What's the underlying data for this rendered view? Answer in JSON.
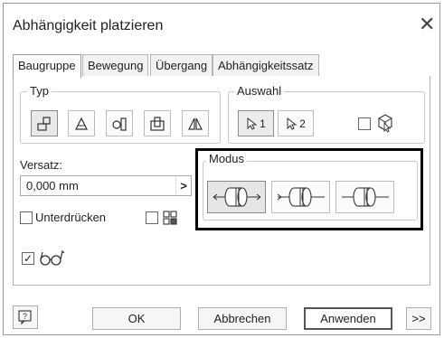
{
  "dialog": {
    "title": "Abhängigkeit platzieren",
    "close_symbol": "✕"
  },
  "tabs": [
    {
      "label": "Baugruppe",
      "active": true
    },
    {
      "label": "Bewegung",
      "active": false
    },
    {
      "label": "Übergang",
      "active": false
    },
    {
      "label": "Abhängigkeitssatz",
      "active": false
    }
  ],
  "type_group": {
    "label": "Typ",
    "buttons": [
      {
        "icon": "mate-constraint-icon",
        "pressed": true
      },
      {
        "icon": "angle-constraint-icon",
        "pressed": false
      },
      {
        "icon": "tangent-constraint-icon",
        "pressed": false
      },
      {
        "icon": "insert-constraint-icon",
        "pressed": false
      },
      {
        "icon": "symmetry-constraint-icon",
        "pressed": false
      }
    ]
  },
  "selection_group": {
    "label": "Auswahl",
    "buttons": [
      {
        "icon": "cursor-select-icon",
        "number": "1",
        "active": true
      },
      {
        "icon": "cursor-select-icon",
        "number": "2",
        "active": false
      }
    ],
    "predict_offset_checked": false,
    "predict_icon": "cube-cursor-icon"
  },
  "offset": {
    "label": "Versatz:",
    "value": "0,000 mm",
    "arrow": ">"
  },
  "suppress": {
    "label": "Unterdrücken",
    "checked": false
  },
  "extra_option": {
    "checked": false,
    "icon": "constraint-glyph-icon"
  },
  "preview": {
    "checked": true,
    "icon": "glasses-icon"
  },
  "mode_group": {
    "label": "Modus",
    "buttons": [
      {
        "icon": "mate-flush-icon",
        "active": true
      },
      {
        "icon": "mate-opposed-icon",
        "active": false
      },
      {
        "icon": "mate-aligned-icon",
        "active": false
      }
    ]
  },
  "footer": {
    "help_icon": "help-icon",
    "ok_label": "OK",
    "cancel_label": "Abbrechen",
    "apply_label": "Anwenden",
    "more_label": ">>"
  }
}
